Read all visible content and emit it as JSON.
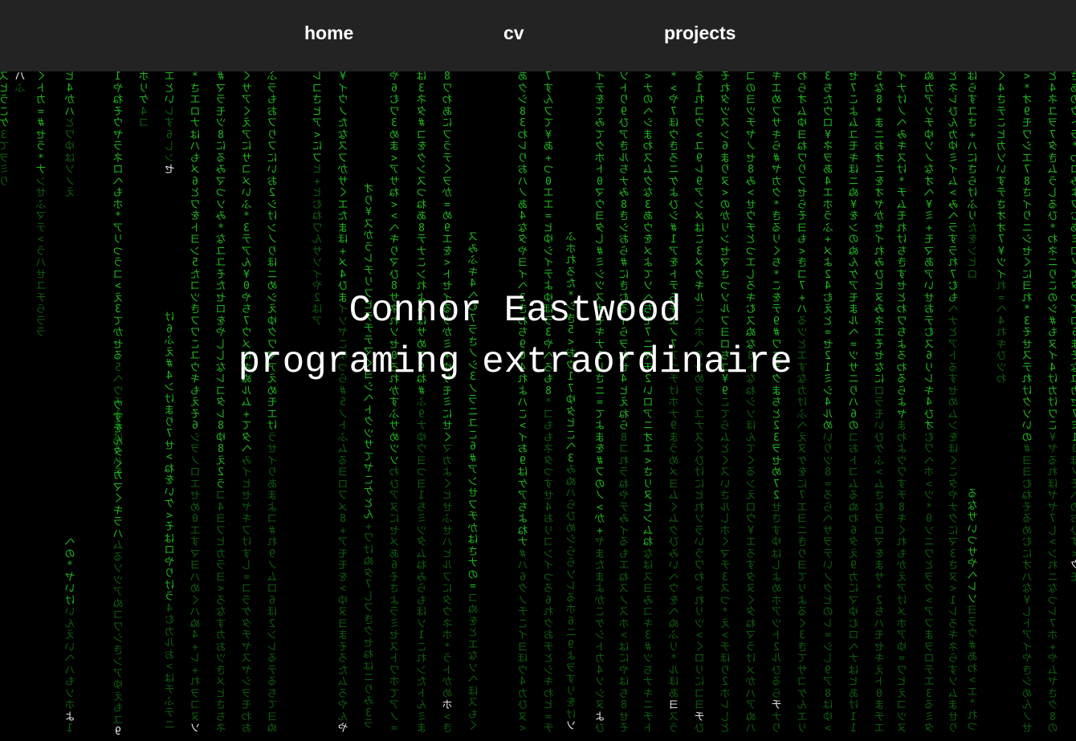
{
  "nav": {
    "links": [
      {
        "label": "home"
      },
      {
        "label": "cv"
      },
      {
        "label": "projects"
      }
    ]
  },
  "hero": {
    "name": "Connor Eastwood",
    "tagline": "programing extraordinaire"
  },
  "matrix": {
    "glyphs": "アイウエオカキクケコサシスセソタチツテトナニヌネノハヒフヘホマミムメモヤユヨラリルレロワヲンあいうえおかきくけこさしすせそたちつてとなにぬねのはひふへほまみむめもやゆよらりるれろわをん0123456789=+*#<>¥",
    "colors": {
      "bright": "#1fb81f",
      "dim": "#0d5e0d",
      "head": "#e8e8e8",
      "background": "#000000"
    }
  }
}
